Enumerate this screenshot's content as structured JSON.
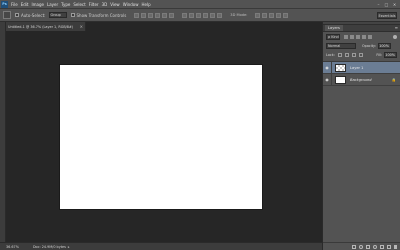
{
  "app": {
    "logo_text": "Ps"
  },
  "menu": [
    "File",
    "Edit",
    "Image",
    "Layer",
    "Type",
    "Select",
    "Filter",
    "3D",
    "View",
    "Window",
    "Help"
  ],
  "window_controls": [
    "–",
    "□",
    "✕"
  ],
  "options_bar": {
    "auto_select_label": "Auto-Select:",
    "auto_select_value": "Group",
    "show_transform_label": "Show Transform Controls",
    "mode_3d_label": "3D Mode:",
    "workspace_value": "Essentials"
  },
  "document": {
    "tab_title": "Untitled-1 @ 36.7% (Layer 1, RGB/8#)",
    "close_glyph": "×",
    "canvas_color": "#ffffff"
  },
  "status_bar": {
    "zoom": "36.67%",
    "doc_info": "Doc: 24.9M/0 bytes",
    "arrow": "▸"
  },
  "layers_panel": {
    "tab_label": "Layers",
    "menu_glyph": "≡",
    "kind_value": "ρ Kind",
    "blend_mode": "Normal",
    "opacity_label": "Opacity:",
    "opacity_value": "100%",
    "lock_label": "Lock:",
    "fill_label": "Fill:",
    "fill_value": "100%",
    "layers": [
      {
        "name": "Layer 1",
        "selected": true,
        "visible_glyph": "◉"
      },
      {
        "name": "Background",
        "selected": false,
        "visible_glyph": "◉",
        "lock_glyph": "🔒"
      }
    ]
  },
  "colors": {
    "chrome": "#535353",
    "workspace": "#262626",
    "selected_layer": "#6b7d94"
  }
}
